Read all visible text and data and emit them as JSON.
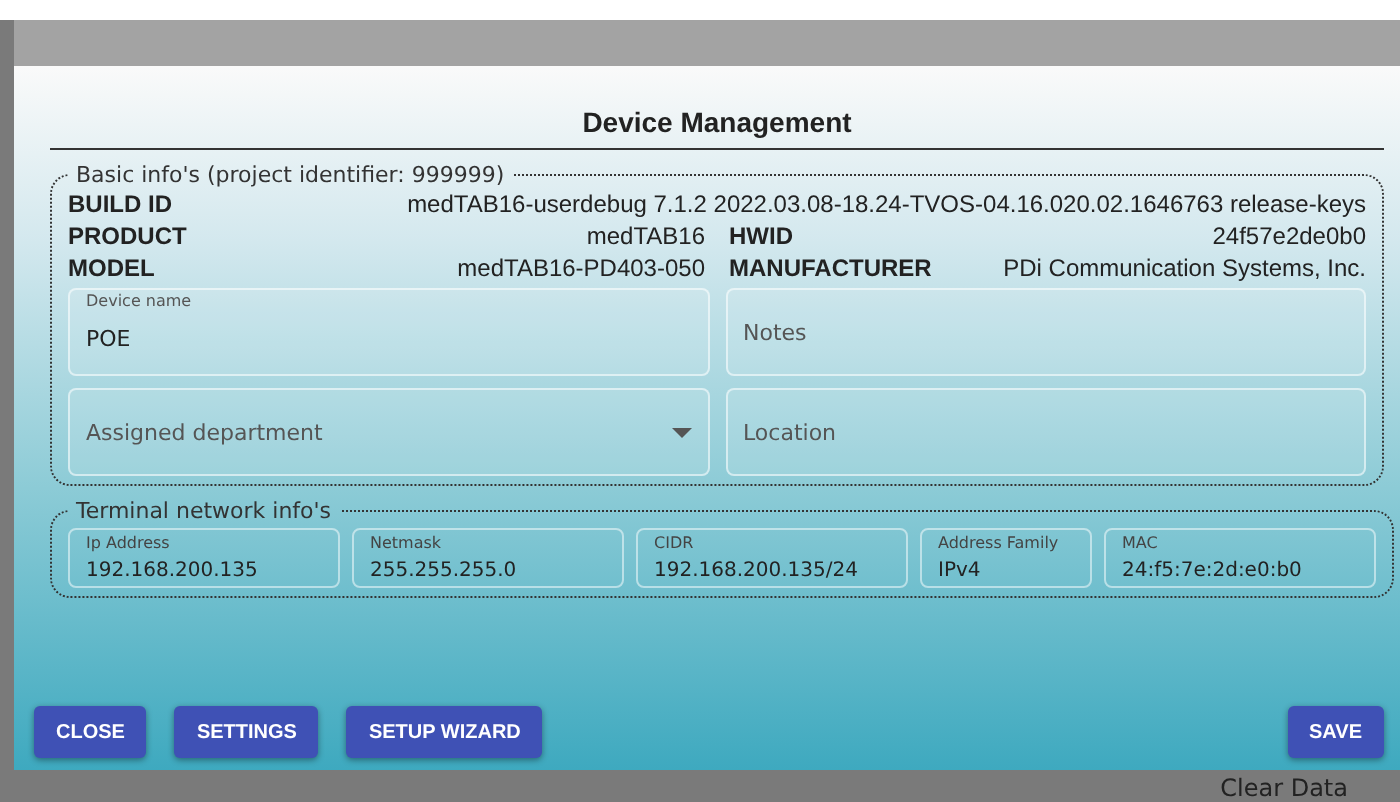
{
  "dialog": {
    "title": "Device Management"
  },
  "basic_info": {
    "legend": "Basic info's (project identifier: 999999)",
    "build_id": {
      "label": "BUILD ID",
      "value": "medTAB16-userdebug 7.1.2 2022.03.08-18.24-TVOS-04.16.020.02.1646763 release-keys"
    },
    "pairs": [
      {
        "label": "PRODUCT",
        "value": "medTAB16"
      },
      {
        "label": "HWID",
        "value": "24f57e2de0b0"
      },
      {
        "label": "MODEL",
        "value": "medTAB16-PD403-050"
      },
      {
        "label": "MANUFACTURER",
        "value": "PDi Communication Systems, Inc."
      }
    ],
    "fields": [
      {
        "kind": "text",
        "label": "Device name",
        "value": "POE"
      },
      {
        "kind": "text",
        "placeholder": "Notes"
      },
      {
        "kind": "select",
        "placeholder": "Assigned department"
      },
      {
        "kind": "text",
        "placeholder": "Location"
      }
    ]
  },
  "network_info": {
    "legend": "Terminal network info's",
    "fields": [
      {
        "label": "Ip Address",
        "value": "192.168.200.135"
      },
      {
        "label": "Netmask",
        "value": "255.255.255.0"
      },
      {
        "label": "CIDR",
        "value": "192.168.200.135/24"
      },
      {
        "label": "Address Family",
        "value": "IPv4"
      },
      {
        "label": "MAC",
        "value": "24:f5:7e:2d:e0:b0"
      }
    ]
  },
  "buttons_left": [
    "CLOSE",
    "SETTINGS",
    "SETUP WIZARD"
  ],
  "buttons_right": [
    "SAVE"
  ],
  "background_text": "Clear Data"
}
